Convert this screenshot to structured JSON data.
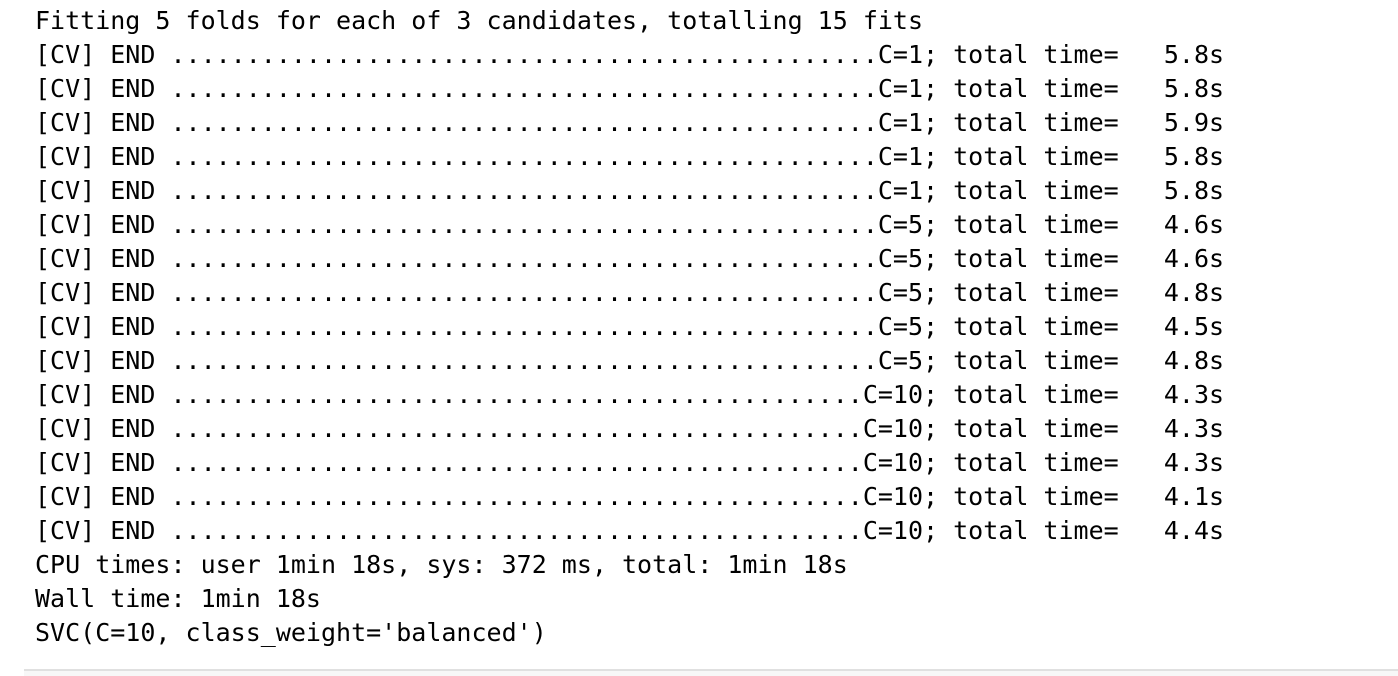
{
  "output": {
    "header": "Fitting 5 folds for each of 3 candidates, totalling 15 fits",
    "cv_lines": [
      "[CV] END ...............................................C=1; total time=   5.8s",
      "[CV] END ...............................................C=1; total time=   5.8s",
      "[CV] END ...............................................C=1; total time=   5.9s",
      "[CV] END ...............................................C=1; total time=   5.8s",
      "[CV] END ...............................................C=1; total time=   5.8s",
      "[CV] END ...............................................C=5; total time=   4.6s",
      "[CV] END ...............................................C=5; total time=   4.6s",
      "[CV] END ...............................................C=5; total time=   4.8s",
      "[CV] END ...............................................C=5; total time=   4.5s",
      "[CV] END ...............................................C=5; total time=   4.8s",
      "[CV] END ..............................................C=10; total time=   4.3s",
      "[CV] END ..............................................C=10; total time=   4.3s",
      "[CV] END ..............................................C=10; total time=   4.3s",
      "[CV] END ..............................................C=10; total time=   4.1s",
      "[CV] END ..............................................C=10; total time=   4.4s"
    ],
    "cpu_times": "CPU times: user 1min 18s, sys: 372 ms, total: 1min 18s",
    "wall_time": "Wall time: 1min 18s",
    "result": "SVC(C=10, class_weight='balanced')"
  }
}
